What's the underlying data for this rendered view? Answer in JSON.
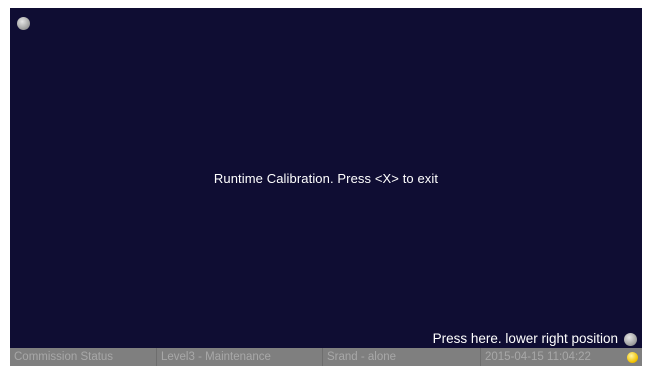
{
  "screen": {
    "center_message": "Runtime Calibration. Press <X> to exit",
    "lower_right_hint": "Press here. lower right position"
  },
  "status_bar": {
    "commission_status": "Commission Status",
    "access_level": "Level3 - Maintenance",
    "mode": "Srand - alone",
    "datetime": "2015-04-15 11:04:22"
  },
  "colors": {
    "background": "#0f0d33",
    "status_bar": "#7f7f7f",
    "indicator_lamp": "#f2c200"
  },
  "icons": {
    "top_left_target": "calibration-point-icon",
    "bottom_right_target": "calibration-point-icon",
    "status_lamp": "status-lamp-icon"
  }
}
